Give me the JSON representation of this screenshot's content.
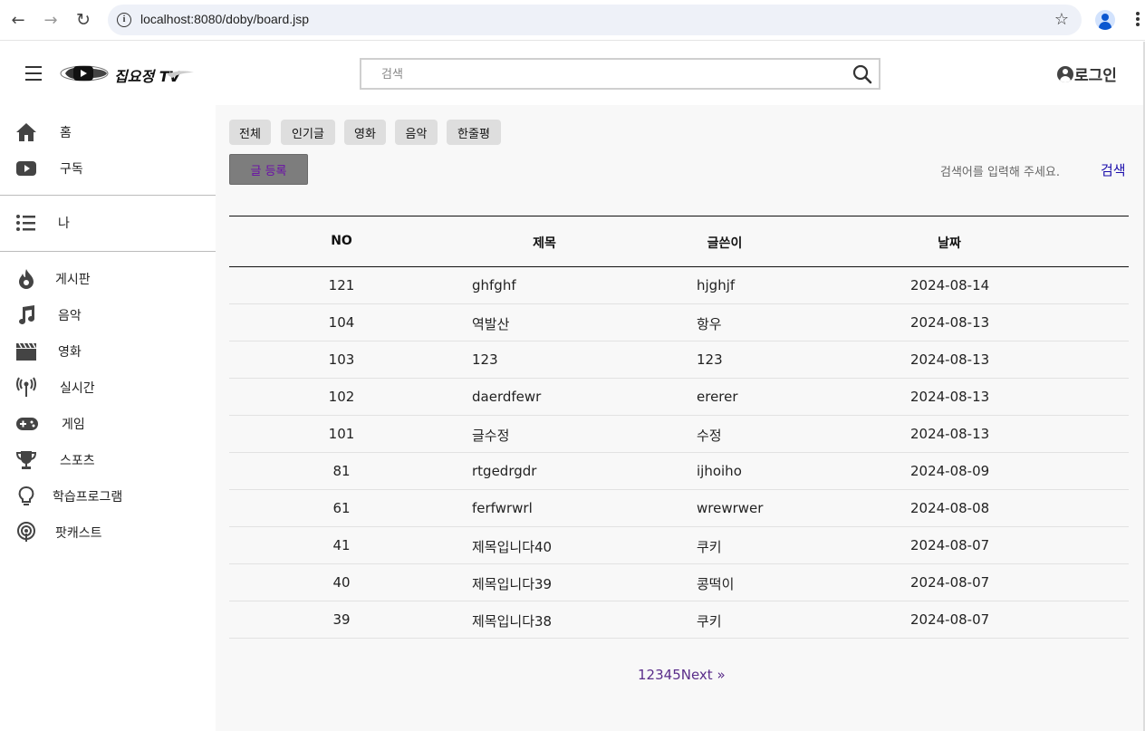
{
  "browser": {
    "url": "localhost:8080/doby/board.jsp",
    "back_icon": "←",
    "forward_icon": "→",
    "reload_icon": "↻",
    "star_icon": "☆"
  },
  "header": {
    "logo_text": "집요정 TV",
    "search_placeholder": "검색",
    "login_label": "로그인"
  },
  "sidebar": {
    "groups": [
      [
        {
          "label": "홈",
          "icon": "home-icon"
        },
        {
          "label": "구독",
          "icon": "subscription-icon"
        }
      ],
      [
        {
          "label": "나",
          "icon": "list-icon"
        }
      ],
      [
        {
          "label": "게시판",
          "icon": "fire-icon"
        },
        {
          "label": "음악",
          "icon": "music-icon"
        },
        {
          "label": "영화",
          "icon": "clapperboard-icon"
        },
        {
          "label": "실시간",
          "icon": "broadcast-icon"
        },
        {
          "label": "게임",
          "icon": "gamepad-icon"
        },
        {
          "label": "스포츠",
          "icon": "trophy-icon"
        },
        {
          "label": "학습프로그램",
          "icon": "lightbulb-icon"
        },
        {
          "label": "팟캐스트",
          "icon": "podcast-icon"
        }
      ]
    ]
  },
  "board": {
    "categories": [
      "전체",
      "인기글",
      "영화",
      "음악",
      "한줄평"
    ],
    "write_button": "글 등록",
    "search_hint": "검색어를 입력해 주세요.",
    "search_link": "검색",
    "columns": [
      "NO",
      "제목",
      "글쓴이",
      "날짜"
    ],
    "rows": [
      {
        "no": "121",
        "title": "ghfghf",
        "author": "hjghjf",
        "date": "2024-08-14"
      },
      {
        "no": "104",
        "title": "역발산",
        "author": "항우",
        "date": "2024-08-13"
      },
      {
        "no": "103",
        "title": "123",
        "author": "123",
        "date": "2024-08-13"
      },
      {
        "no": "102",
        "title": "daerdfewr",
        "author": "ererer",
        "date": "2024-08-13"
      },
      {
        "no": "101",
        "title": "글수정",
        "author": "수정",
        "date": "2024-08-13"
      },
      {
        "no": "81",
        "title": "rtgedrgdr",
        "author": "ijhoiho",
        "date": "2024-08-09"
      },
      {
        "no": "61",
        "title": "ferfwrwrl",
        "author": "wrewrwer",
        "date": "2024-08-08"
      },
      {
        "no": "41",
        "title": "제목입니다40",
        "author": "쿠키",
        "date": "2024-08-07"
      },
      {
        "no": "40",
        "title": "제목입니다39",
        "author": "콩떡이",
        "date": "2024-08-07"
      },
      {
        "no": "39",
        "title": "제목입니다38",
        "author": "쿠키",
        "date": "2024-08-07"
      }
    ],
    "pages": [
      "1",
      "2",
      "3",
      "4",
      "5"
    ],
    "next_label": "Next »"
  }
}
